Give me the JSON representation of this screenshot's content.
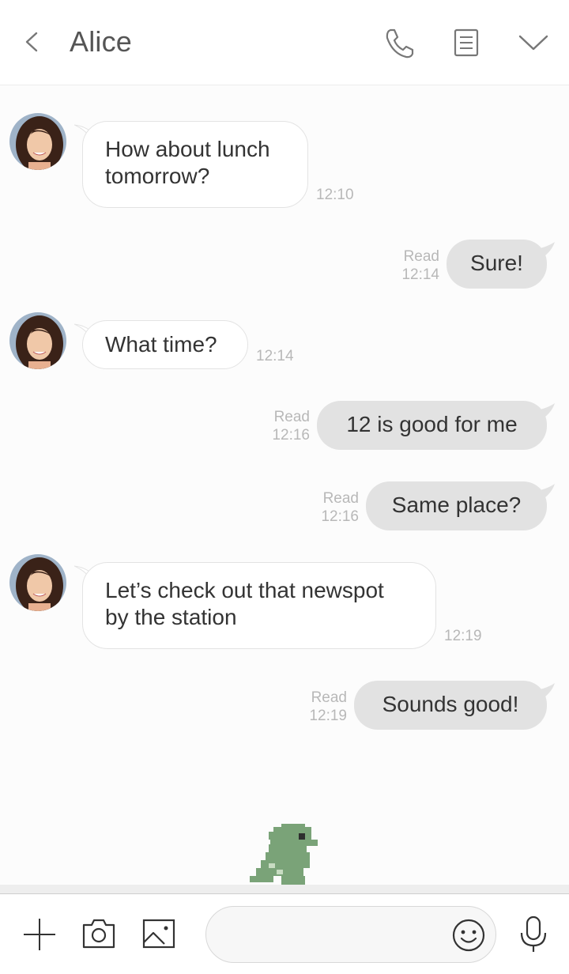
{
  "header": {
    "title": "Alice"
  },
  "messages": [
    {
      "direction": "in",
      "text_line1": "How about lunch",
      "text_line2": "tomorrow?",
      "time": "12:10"
    },
    {
      "direction": "out",
      "text": "Sure!",
      "read": "Read",
      "time": "12:14"
    },
    {
      "direction": "in",
      "text": "What time?",
      "time": "12:14"
    },
    {
      "direction": "out",
      "text": "12 is good for me",
      "read": "Read",
      "time": "12:16"
    },
    {
      "direction": "out",
      "text": "Same place?",
      "read": "Read",
      "time": "12:16"
    },
    {
      "direction": "in",
      "text_line1": "Let’s check out that newspot",
      "text_line2": "by the station",
      "time": "12:19"
    },
    {
      "direction": "out",
      "text": "Sounds good!",
      "read": "Read",
      "time": "12:19"
    }
  ],
  "composer": {
    "value": "",
    "placeholder": ""
  },
  "icons": {
    "back": "chevron-left-icon",
    "call": "phone-icon",
    "notes": "note-icon",
    "menu": "chevron-down-icon",
    "add": "plus-icon",
    "camera": "camera-icon",
    "gallery": "image-icon",
    "emoji": "smiley-icon",
    "mic": "microphone-icon",
    "mascot": "pixel-dinosaur"
  },
  "colors": {
    "incoming_bubble": "#ffffff",
    "outgoing_bubble": "#e2e2e2",
    "meta_text": "#b8b8b8",
    "mascot": "#7aa378"
  }
}
